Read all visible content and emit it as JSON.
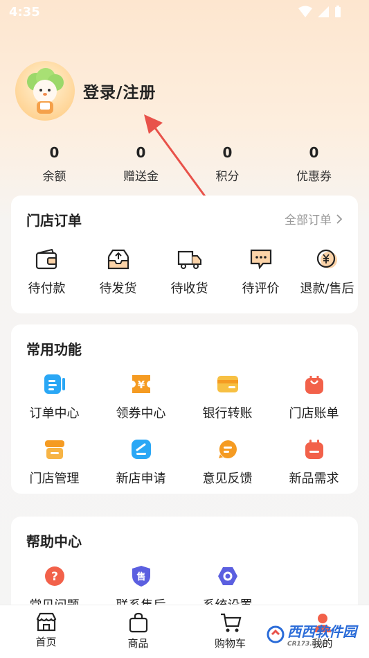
{
  "status": {
    "time": "4:35"
  },
  "profile": {
    "login_label": "登录/注册"
  },
  "balances": [
    {
      "value": "0",
      "label": "余额"
    },
    {
      "value": "0",
      "label": "赠送金"
    },
    {
      "value": "0",
      "label": "积分"
    },
    {
      "value": "0",
      "label": "优惠券"
    }
  ],
  "store_orders": {
    "title": "门店订单",
    "all_link": "全部订单",
    "items": [
      {
        "label": "待付款",
        "icon": "wallet-icon"
      },
      {
        "label": "待发货",
        "icon": "box-upload-icon"
      },
      {
        "label": "待收货",
        "icon": "truck-icon"
      },
      {
        "label": "待评价",
        "icon": "comment-icon"
      },
      {
        "label": "退款/售后",
        "icon": "yen-coin-icon"
      }
    ]
  },
  "common_functions": {
    "title": "常用功能",
    "items": [
      {
        "label": "订单中心",
        "icon": "order-center-icon",
        "color": "#2aa7f5"
      },
      {
        "label": "领券中心",
        "icon": "coupon-icon",
        "color": "#f59b22"
      },
      {
        "label": "银行转账",
        "icon": "bank-card-icon",
        "color": "#f7c043"
      },
      {
        "label": "门店账单",
        "icon": "bag-icon",
        "color": "#f2614a"
      },
      {
        "label": "门店管理",
        "icon": "store-icon",
        "color": "#f59b22"
      },
      {
        "label": "新店申请",
        "icon": "apply-icon",
        "color": "#2aa7f5"
      },
      {
        "label": "意见反馈",
        "icon": "feedback-icon",
        "color": "#f59b22"
      },
      {
        "label": "新品需求",
        "icon": "calendar-icon",
        "color": "#f2614a"
      }
    ]
  },
  "help_center": {
    "title": "帮助中心",
    "items": [
      {
        "label": "常见问题",
        "icon": "question-icon",
        "color": "#f2614a"
      },
      {
        "label": "联系售后",
        "icon": "after-sales-shield-icon",
        "color": "#5b5fe0",
        "glyph": "售"
      },
      {
        "label": "系统设置",
        "icon": "settings-hex-icon",
        "color": "#5b5fe0"
      }
    ]
  },
  "tab_bar": [
    {
      "label": "首页",
      "icon": "home-store-icon"
    },
    {
      "label": "商品",
      "icon": "shopping-bag-icon"
    },
    {
      "label": "购物车",
      "icon": "cart-icon"
    },
    {
      "label": "我的",
      "icon": "profile-icon"
    }
  ],
  "watermark": {
    "text": "西西软件园",
    "sub": "CR173.COM"
  }
}
